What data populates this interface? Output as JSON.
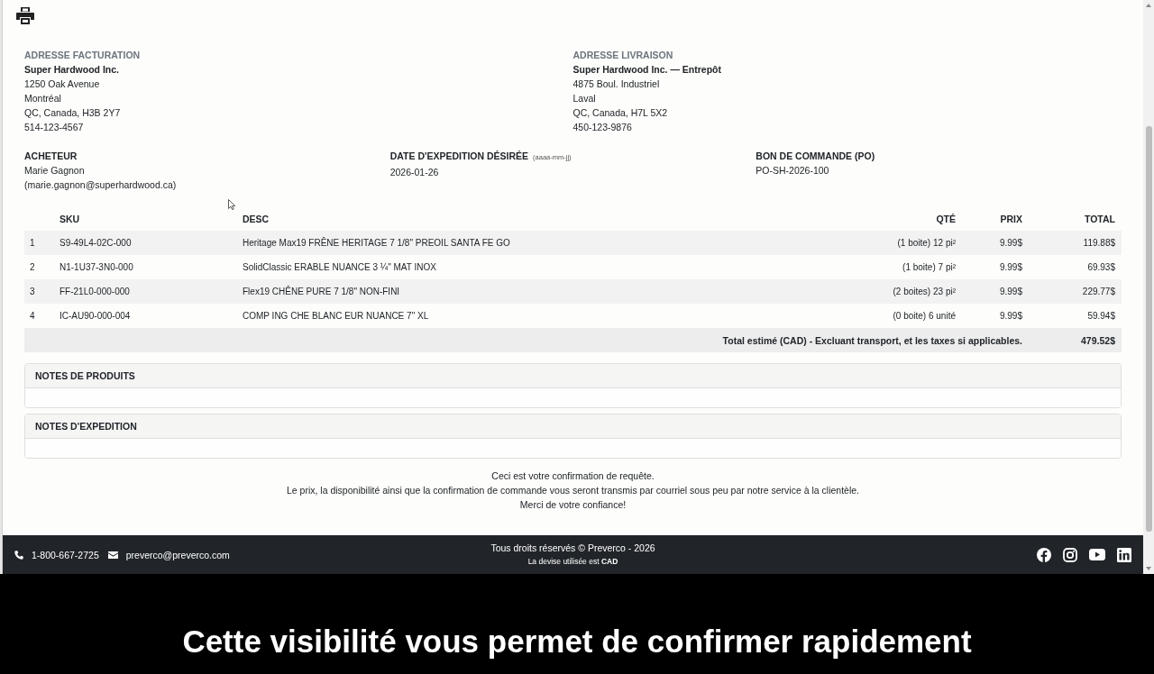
{
  "billing_address": {
    "heading": "ADRESSE FACTURATION",
    "name": "Super Hardwood Inc.",
    "lines": [
      "1250 Oak Avenue",
      "Montréal",
      "QC, Canada, H3B 2Y7",
      "514-123-4567"
    ]
  },
  "shipping_address": {
    "heading": "ADRESSE LIVRAISON",
    "name": "Super Hardwood Inc. — Entrepôt",
    "lines": [
      "4875 Boul. Industriel",
      "Laval",
      "QC, Canada, H7L 5X2",
      "450-123-9876"
    ]
  },
  "details": [
    {
      "heading": "ACHETEUR",
      "lines": [
        "Marie Gagnon",
        "(marie.gagnon@superhardwood.ca)"
      ]
    },
    {
      "heading": "DATE D'EXPEDITION DÉSIRÉE",
      "hint": "(aaaa-mm-jj)",
      "lines": [
        "2026-01-26"
      ]
    },
    {
      "heading": "BON DE COMMANDE (PO)",
      "lines": [
        "PO-SH-2026-100"
      ]
    }
  ],
  "table": {
    "columns": [
      "SKU",
      "DESC",
      "QTÉ",
      "PRIX",
      "TOTAL"
    ],
    "rows": [
      {
        "line": "1",
        "sku": "S9-49L4-02C-000",
        "desc": "Heritage Max19 FRÊNE HERITAGE 7 1/8\" PREOIL SANTA FE GO",
        "qty": "(1 boite) 12 pi²",
        "price": "9.99$",
        "total": "119.88$"
      },
      {
        "line": "2",
        "sku": "N1-1U37-3N0-000",
        "desc": "SolidClassic ERABLE NUANCE 3 ¼\" MAT INOX",
        "qty": "(1 boite) 7 pi²",
        "price": "9.99$",
        "total": "69.93$"
      },
      {
        "line": "3",
        "sku": "FF-21L0-000-000",
        "desc": "Flex19 CHÊNE PURE 7 1/8\" NON-FINI",
        "qty": "(2 boites) 23 pi²",
        "price": "9.99$",
        "total": "229.77$"
      },
      {
        "line": "4",
        "sku": "IC-AU90-000-004",
        "desc": "COMP ING CHE BLANC EUR NUANCE 7\" XL",
        "qty": "(0 boite) 6 unité",
        "price": "9.99$",
        "total": "59.94$"
      }
    ],
    "total": {
      "label": "Total estimé (CAD) - Excluant transport, et les taxes si applicables.",
      "value": "479.52$"
    }
  },
  "notes": [
    {
      "heading": "NOTES DE PRODUITS"
    },
    {
      "heading": "NOTES D'EXPEDITION"
    }
  ],
  "confirmation": [
    "Ceci est votre confirmation de requête.",
    "Le prix, la disponibilité ainsi que la confirmation de commande vous seront transmis par courriel sous peu par notre service à la clientèle.",
    "Merci de votre confiance!"
  ],
  "footer": {
    "phone": "1-800-667-2725",
    "email": "preverco@preverco.com",
    "copyright": "Tous droits réservés © Preverco - 2026",
    "currency_note": "La devise utilisée est **CAD**"
  },
  "caption": "Cette visibilité vous permet de confirmer rapidement"
}
